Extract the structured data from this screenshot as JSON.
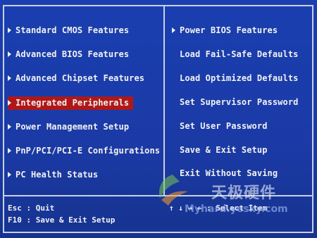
{
  "left_menu": [
    {
      "label": "Standard CMOS Features",
      "selected": false
    },
    {
      "label": "Advanced BIOS Features",
      "selected": false
    },
    {
      "label": "Advanced Chipset Features",
      "selected": false
    },
    {
      "label": "Integrated Peripherals",
      "selected": true
    },
    {
      "label": "Power Management Setup",
      "selected": false
    },
    {
      "label": "PnP/PCI/PCI-E Configurations",
      "selected": false
    },
    {
      "label": "PC Health Status",
      "selected": false
    }
  ],
  "right_menu": [
    {
      "label": "Power BIOS Features",
      "arrow": true
    },
    {
      "label": "Load Fail-Safe Defaults",
      "arrow": false
    },
    {
      "label": "Load Optimized Defaults",
      "arrow": false
    },
    {
      "label": "Set Supervisor Password",
      "arrow": false
    },
    {
      "label": "Set User Password",
      "arrow": false
    },
    {
      "label": "Save & Exit Setup",
      "arrow": false
    },
    {
      "label": "Exit Without Saving",
      "arrow": false
    }
  ],
  "footer": {
    "esc_hint": "Esc : Quit",
    "f10_hint": "F10 : Save & Exit Setup",
    "nav_hint": "↑ ↓ → ←   : Select Item"
  },
  "watermark": {
    "chinese": "天极硬件",
    "url": "Myhard.yesky.com"
  },
  "colors": {
    "background": "#1b3aa6",
    "text": "#f2f2f2",
    "highlight": "#b01818",
    "border": "#c8d0e8"
  }
}
